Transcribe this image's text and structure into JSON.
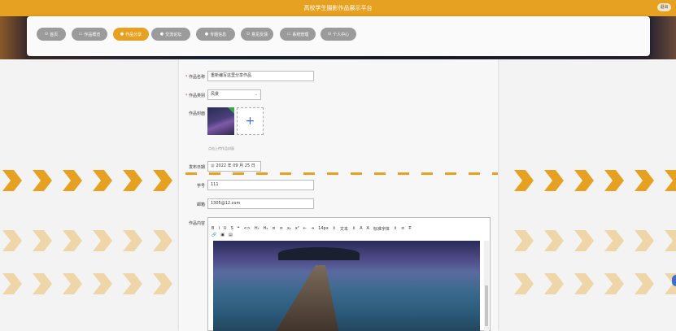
{
  "header": {
    "site_title": "高校学生摄影作品展示平台",
    "exit_label": "退出"
  },
  "nav": [
    {
      "label": "首页",
      "icon": "home-icon",
      "glyph": "⊙"
    },
    {
      "label": "作品概览",
      "icon": "folder-icon",
      "glyph": "▭"
    },
    {
      "label": "作品分享",
      "icon": "share-icon",
      "glyph": "●"
    },
    {
      "label": "交流论坛",
      "icon": "chat-icon",
      "glyph": "●"
    },
    {
      "label": "专题信息",
      "icon": "info-icon",
      "glyph": "●"
    },
    {
      "label": "意见反馈",
      "icon": "feedback-icon",
      "glyph": "⊙"
    },
    {
      "label": "系统管理",
      "icon": "settings-icon",
      "glyph": "▭"
    },
    {
      "label": "个人中心",
      "icon": "user-icon",
      "glyph": "⊙"
    }
  ],
  "nav_active_index": 2,
  "form": {
    "name_label": "作品名称",
    "name_value": "重新编写这里分享作品",
    "category_label": "作品类别",
    "category_value": "风景",
    "cover_label": "作品封面",
    "cover_hint": "点击上传作品封面",
    "upload_glyph": "+",
    "date_label": "发布日期",
    "date_value": "2022 年 09 月 25 日",
    "student_no_label": "学号",
    "student_no_value": "111",
    "email_label": "邮箱",
    "email_value": "1305@12.com",
    "content_label": "作品内容"
  },
  "toolbar": {
    "row1": [
      "B",
      "I",
      "U",
      "S",
      "❝",
      "<>",
      "H₁",
      "H₂",
      "≡",
      "≡",
      "x₂",
      "x²",
      "⇤",
      "⇥",
      "14px",
      "⇕",
      "文本",
      "⇕",
      "A",
      "A",
      "标准字体",
      "⇕",
      "≡",
      "T̶"
    ],
    "row2": [
      "🔗",
      "▣",
      "▤"
    ]
  },
  "colors": {
    "accent": "#e6a122",
    "nav_inactive": "#9b9b9b",
    "upload_plus": "#3f6fc4"
  }
}
